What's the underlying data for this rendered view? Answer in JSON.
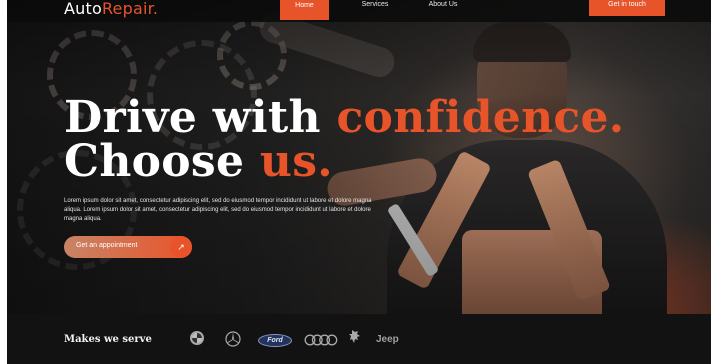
{
  "nav": {
    "logo_main": "Auto",
    "logo_accent": "Repair.",
    "links": [
      {
        "label": "Home"
      },
      {
        "label": "Services"
      },
      {
        "label": "About Us"
      }
    ],
    "cta_label": "Get in touch"
  },
  "hero": {
    "headline_part1": "Drive with",
    "headline_accent1": "confidence.",
    "headline_part2": "Choose",
    "headline_accent2": "us.",
    "description": "Lorem ipsum dolor sit amet, consectetur adipiscing elit, sed do eiusmod tempor incididunt ut labore et dolore magna aliqua. Lorem ipsum dolor sit amet, consectetur adipiscing elit, sed do eiusmod tempor incididunt ut labore et dolore magna aliqua.",
    "cta_label": "Get an appointment",
    "cta_icon": "arrow-up-right-icon"
  },
  "brands": {
    "title": "Makes we serve",
    "items": [
      {
        "name": "bmw-logo"
      },
      {
        "name": "mercedes-logo"
      },
      {
        "name": "ford-logo",
        "text": "Ford"
      },
      {
        "name": "audi-logo"
      },
      {
        "name": "peugeot-logo"
      },
      {
        "name": "jeep-logo",
        "text": "Jeep"
      }
    ]
  },
  "colors": {
    "accent": "#e8542a",
    "background": "#0c0c0c",
    "text": "#ffffff"
  }
}
